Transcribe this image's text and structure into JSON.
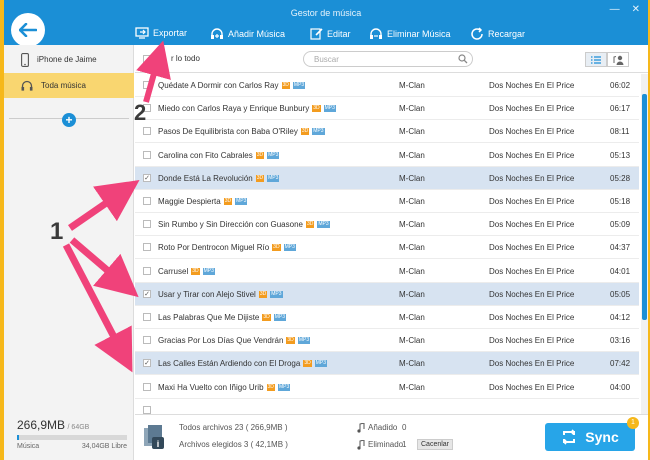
{
  "app_title": "Gestor de música",
  "toolbar": {
    "export": "Exportar",
    "add": "Añadir Música",
    "edit": "Editar",
    "delete": "Eliminar Música",
    "reload": "Recargar"
  },
  "sidebar": {
    "device": "iPhone de Jaime",
    "all_music": "Toda música"
  },
  "storage": {
    "used": "266,9MB",
    "total": "/ 64GB",
    "type_label": "Música",
    "free": "34,04GB Libre",
    "used_fraction": 0.004
  },
  "list_header": {
    "select_all": "r lo todo",
    "search_placeholder": "Buscar"
  },
  "songs": [
    {
      "title": "Quédate A Dormir con Carlos Ray",
      "artist": "M-Clan",
      "album": "Dos Noches En El Price",
      "time": "06:02",
      "checked": false
    },
    {
      "title": "Miedo con Carlos Raya y Enrique Bunbury",
      "artist": "M-Clan",
      "album": "Dos Noches En El Price",
      "time": "06:17",
      "checked": false
    },
    {
      "title": "Pasos De Equilibrista con Baba O'Riley",
      "artist": "M-Clan",
      "album": "Dos Noches En El Price",
      "time": "08:11",
      "checked": false
    },
    {
      "title": "Carolina con Fito Cabrales",
      "artist": "M-Clan",
      "album": "Dos Noches En El Price",
      "time": "05:13",
      "checked": false
    },
    {
      "title": "Donde Está La Revolución",
      "artist": "M-Clan",
      "album": "Dos Noches En El Price",
      "time": "05:28",
      "checked": true
    },
    {
      "title": "Maggie Despierta",
      "artist": "M-Clan",
      "album": "Dos Noches En El Price",
      "time": "05:18",
      "checked": false
    },
    {
      "title": "Sin Rumbo y Sin Dirección con Guasone",
      "artist": "M-Clan",
      "album": "Dos Noches En El Price",
      "time": "05:09",
      "checked": false
    },
    {
      "title": "Roto Por Dentrocon Miguel Río",
      "artist": "M-Clan",
      "album": "Dos Noches En El Price",
      "time": "04:37",
      "checked": false
    },
    {
      "title": "Carrusel",
      "artist": "M-Clan",
      "album": "Dos Noches En El Price",
      "time": "04:01",
      "checked": false
    },
    {
      "title": "Usar y Tirar con Alejo Stivel",
      "artist": "M-Clan",
      "album": "Dos Noches En El Price",
      "time": "05:05",
      "checked": true
    },
    {
      "title": "Las Palabras Que Me Dijiste",
      "artist": "M-Clan",
      "album": "Dos Noches En El Price",
      "time": "04:12",
      "checked": false
    },
    {
      "title": "Gracias Por Los Días Que Vendrán",
      "artist": "M-Clan",
      "album": "Dos Noches En El Price",
      "time": "03:16",
      "checked": false
    },
    {
      "title": "Las Calles Están Ardiendo con El Droga",
      "artist": "M-Clan",
      "album": "Dos Noches En El Price",
      "time": "07:42",
      "checked": true
    },
    {
      "title": "Maxi Ha Vuelto con Iñigo Urib",
      "artist": "M-Clan",
      "album": "Dos Noches En El Price",
      "time": "04:00",
      "checked": false
    },
    {
      "title": "",
      "artist": "",
      "album": "",
      "time": "",
      "checked": false
    }
  ],
  "badge_3d": "3D",
  "badge_mp3": "MP3",
  "footer": {
    "total": "Todos archivos 23 ( 266,9MB )",
    "chosen": "Archivos elegidos 3 ( 42,1MB )",
    "added_label": "Añadido",
    "added_count": "0",
    "deleted_label": "Eliminado",
    "deleted_count": "1",
    "cancel": "Cacenlar",
    "sync": "Sync",
    "sync_badge": "1"
  },
  "annotations": {
    "label_1": "1",
    "label_2": "2"
  },
  "colors": {
    "accent": "#1b8fd6",
    "selected_row": "#d7e3f1",
    "sidebar_active": "#f9d670",
    "annotation_arrow": "#f0427a",
    "frame": "#f6b81a"
  }
}
